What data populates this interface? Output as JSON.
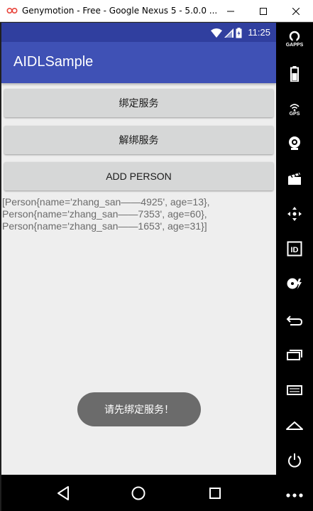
{
  "window": {
    "title": "Genymotion - Free - Google Nexus 5 - 5.0.0 ..."
  },
  "statusbar": {
    "time": "11:25"
  },
  "app": {
    "title": "AIDLSample",
    "buttons": {
      "bind": "绑定服务",
      "unbind": "解绑服务",
      "add_person": "ADD PERSON"
    },
    "result_lines": [
      "[Person{name='zhang_san——4925', age=13},",
      "Person{name='zhang_san——7353', age=60},",
      "Person{name='zhang_san——1653', age=31}]"
    ],
    "toast": "请先绑定服务！"
  },
  "sidebar": {
    "gapps_label": "GAPPS",
    "gps_label": "GPS",
    "id_label": "ID"
  },
  "colors": {
    "statusbar": "#303f9f",
    "actionbar": "#3f51b5",
    "screen_bg": "#eeeeee",
    "button_bg": "#d6d7d7",
    "toast_bg": "#6b6b6b"
  }
}
